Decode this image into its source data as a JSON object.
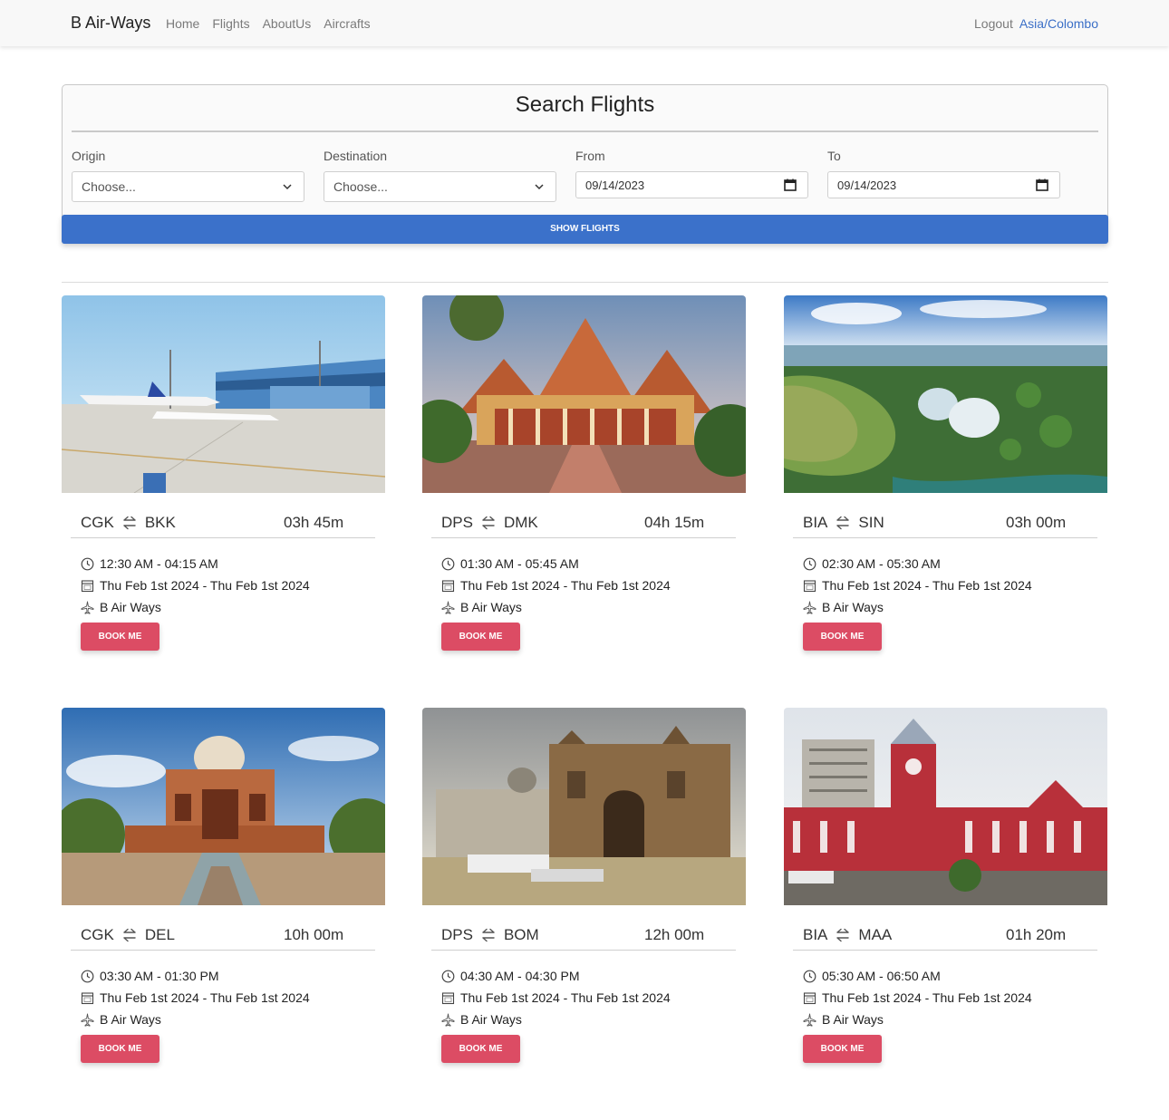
{
  "nav": {
    "brand": "B Air-Ways",
    "links": [
      "Home",
      "Flights",
      "AboutUs",
      "Aircrafts"
    ],
    "logout": "Logout",
    "timezone": "Asia/Colombo"
  },
  "search": {
    "title": "Search Flights",
    "origin_label": "Origin",
    "origin_value": "Choose...",
    "destination_label": "Destination",
    "destination_value": "Choose...",
    "from_label": "From",
    "from_value": "09/14/2023",
    "to_label": "To",
    "to_value": "09/14/2023",
    "button": "SHOW FLIGHTS"
  },
  "colors": {
    "primary": "#3b71ca",
    "book_button": "#dc4c64",
    "timezone_link": "#3b6fc7"
  },
  "flights": [
    {
      "origin": "CGK",
      "destination": "BKK",
      "duration": "03h 45m",
      "time": "12:30 AM - 04:15 AM",
      "dates": "Thu Feb 1st 2024 - Thu Feb 1st 2024",
      "airline": "B Air Ways",
      "button": "BOOK ME",
      "photo": "airport-terminal-photo"
    },
    {
      "origin": "DPS",
      "destination": "DMK",
      "duration": "04h 15m",
      "time": "01:30 AM - 05:45 AM",
      "dates": "Thu Feb 1st 2024 - Thu Feb 1st 2024",
      "airline": "B Air Ways",
      "button": "BOOK ME",
      "photo": "thai-temple-photo"
    },
    {
      "origin": "BIA",
      "destination": "SIN",
      "duration": "03h 00m",
      "time": "02:30 AM - 05:30 AM",
      "dates": "Thu Feb 1st 2024 - Thu Feb 1st 2024",
      "airline": "B Air Ways",
      "button": "BOOK ME",
      "photo": "singapore-gardens-photo"
    },
    {
      "origin": "CGK",
      "destination": "DEL",
      "duration": "10h 00m",
      "time": "03:30 AM - 01:30 PM",
      "dates": "Thu Feb 1st 2024 - Thu Feb 1st 2024",
      "airline": "B Air Ways",
      "button": "BOOK ME",
      "photo": "delhi-tomb-photo"
    },
    {
      "origin": "DPS",
      "destination": "BOM",
      "duration": "12h 00m",
      "time": "04:30 AM - 04:30 PM",
      "dates": "Thu Feb 1st 2024 - Thu Feb 1st 2024",
      "airline": "B Air Ways",
      "button": "BOOK ME",
      "photo": "gateway-of-india-photo"
    },
    {
      "origin": "BIA",
      "destination": "MAA",
      "duration": "01h 20m",
      "time": "05:30 AM - 06:50 AM",
      "dates": "Thu Feb 1st 2024 - Thu Feb 1st 2024",
      "airline": "B Air Ways",
      "button": "BOOK ME",
      "photo": "chennai-station-photo"
    }
  ]
}
